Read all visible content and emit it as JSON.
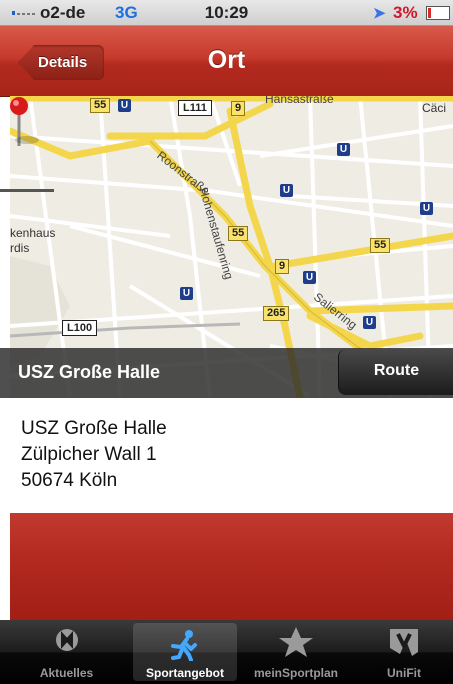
{
  "status": {
    "carrier": "o2-de",
    "network": "3G",
    "time": "10:29",
    "battery_percent": "3%"
  },
  "nav": {
    "back_label": "Details",
    "title": "Ort"
  },
  "map": {
    "labels": {
      "street_hohenstaufenring": "Hohenstaufenring",
      "street_roonstrasse": "Roonstraße",
      "street_salierring": "Salierring",
      "street_hansastrasse": "Hansastraße",
      "area_caci": "Cäci",
      "poi_krankenhaus_1": "kenhaus",
      "poi_krankenhaus_2": "rdis",
      "road_l111": "L111",
      "road_l100": "L100",
      "route_55_a": "55",
      "route_55_b": "55",
      "route_55_c": "55",
      "route_9_a": "9",
      "route_9_b": "9",
      "route_265": "265",
      "ubahn": "U"
    },
    "callout_title": "USZ Große Halle",
    "route_button": "Route"
  },
  "address": {
    "name": "USZ Große Halle",
    "street": "Zülpicher Wall 1",
    "city": "50674 Köln"
  },
  "tabs": [
    {
      "label": "Aktuelles",
      "icon": "logo-icon"
    },
    {
      "label": "Sportangebot",
      "icon": "runner-icon"
    },
    {
      "label": "meinSportplan",
      "icon": "star-icon"
    },
    {
      "label": "UniFit",
      "icon": "unifit-icon"
    }
  ],
  "colors": {
    "nav_red": "#c63a2c",
    "status_blue": "#1e6fe0",
    "battery_red": "#d1182a"
  }
}
